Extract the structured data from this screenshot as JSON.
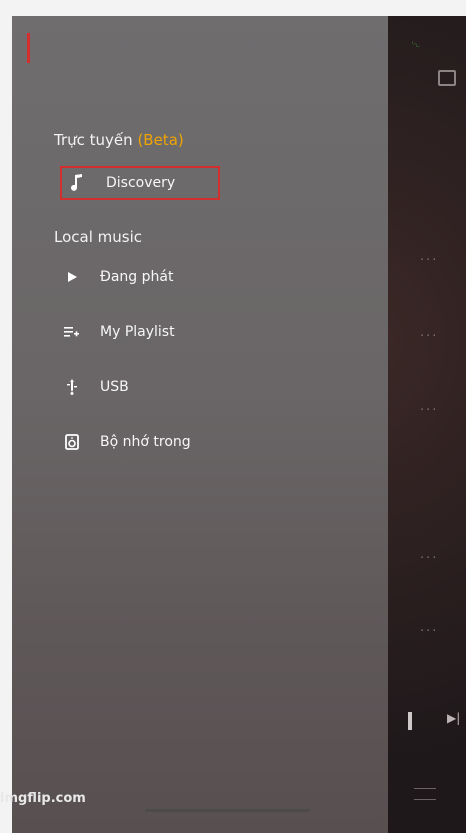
{
  "drawer": {
    "online_label": "Trực tuyến",
    "beta_label": "(Beta)",
    "discovery_label": "Discovery",
    "local_label": "Local music",
    "items": [
      {
        "label": "Đang phát",
        "icon": "play-icon"
      },
      {
        "label": "My Playlist",
        "icon": "playlist-add-icon"
      },
      {
        "label": "USB",
        "icon": "usb-icon"
      },
      {
        "label": "Bộ nhớ trong",
        "icon": "storage-icon"
      }
    ]
  },
  "footer": {
    "watermark": "imgflip.com"
  },
  "colors": {
    "accent": "#f0a400",
    "highlight": "#d32f2f"
  }
}
